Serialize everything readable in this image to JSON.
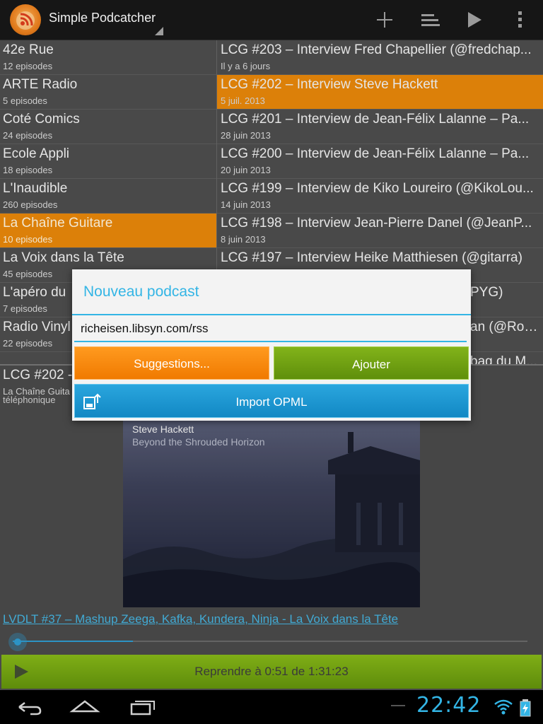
{
  "actionbar": {
    "title": "Simple Podcatcher",
    "icons": [
      "podcast-app-icon",
      "add-icon",
      "sort-icon",
      "play-icon",
      "overflow-menu-icon"
    ]
  },
  "podcasts": [
    {
      "title": "42e Rue",
      "count": "12 episodes",
      "selected": false
    },
    {
      "title": "ARTE Radio",
      "count": "5 episodes",
      "selected": false
    },
    {
      "title": "Coté Comics",
      "count": "24 episodes",
      "selected": false
    },
    {
      "title": "Ecole Appli",
      "count": "18 episodes",
      "selected": false
    },
    {
      "title": "L'Inaudible",
      "count": "260 episodes",
      "selected": false
    },
    {
      "title": "La Chaîne Guitare",
      "count": "10 episodes",
      "selected": true
    },
    {
      "title": "La Voix dans la Tête",
      "count": "45 episodes",
      "selected": false
    },
    {
      "title": "L'apéro du",
      "count": "7 episodes",
      "selected": false
    },
    {
      "title": "Radio Vinyl",
      "count": "22 episodes",
      "selected": false
    }
  ],
  "episodes": [
    {
      "title": "LCG #203 – Interview Fred Chapellier (@fredchap...",
      "date": "Il y a 6 jours",
      "selected": false
    },
    {
      "title": "LCG #202 – Interview Steve Hackett",
      "date": "5 juil. 2013",
      "selected": true
    },
    {
      "title": "LCG #201 – Interview de Jean-Félix Lalanne – Pa...",
      "date": "28 juin 2013",
      "selected": false
    },
    {
      "title": "LCG #200 – Interview de Jean-Félix Lalanne – Pa...",
      "date": "20 juin 2013",
      "selected": false
    },
    {
      "title": "LCG #199 – Interview de Kiko Loureiro (@KikoLou...",
      "date": "14 juin 2013",
      "selected": false
    },
    {
      "title": "LCG #198 – Interview Jean-Pierre Danel (@JeanP...",
      "date": "8 juin 2013",
      "selected": false
    },
    {
      "title": "LCG #197 – Interview Heike Matthiesen (@gitarra)",
      "date": "",
      "selected": false
    },
    {
      "title": "PYG)",
      "date": "",
      "selected": false
    },
    {
      "title": "an (@Rod...",
      "date": "",
      "selected": false
    },
    {
      "title": "bag du M...",
      "date": "",
      "selected": false
    }
  ],
  "detail": {
    "title": "LCG #202 -",
    "podcast": "La Chaîne Guita",
    "description": "téléphonique",
    "cover_artist": "Steve Hackett",
    "cover_album": "Beyond the Shrouded Horizon"
  },
  "player": {
    "track_link": "LVDLT #37 – Mashup Zeega, Kafka, Kundera, Ninja - La Voix dans la Tête",
    "resume_label": "Reprendre à 0:51 de 1:31:23",
    "progress_fraction": 0.0093
  },
  "dialog": {
    "title": "Nouveau podcast",
    "url_value": "richeisen.libsyn.com/rss",
    "suggestions_label": "Suggestions...",
    "add_label": "Ajouter",
    "import_label": "Import OPML"
  },
  "statusbar": {
    "clock": "22:42"
  },
  "colors": {
    "accent_blue": "#33b5e5",
    "selection_orange": "#e8870a",
    "green_button": "#6a9c10",
    "orange_button": "#f58a0c",
    "blue_button": "#1c98d2"
  }
}
